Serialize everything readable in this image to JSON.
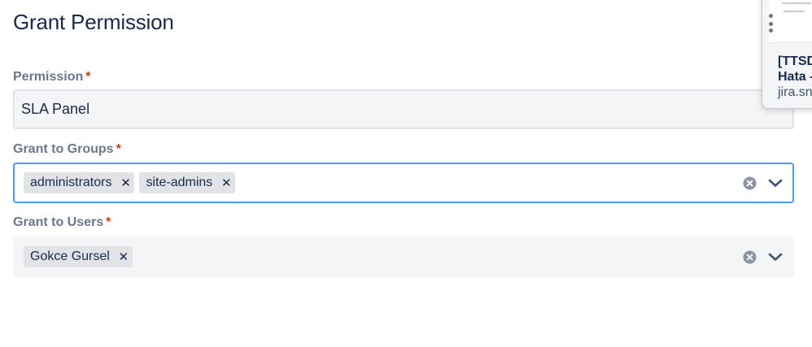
{
  "page": {
    "title": "Grant Permission"
  },
  "form": {
    "required_marker": "*",
    "permission": {
      "label": "Permission",
      "value": "SLA Panel"
    },
    "groups": {
      "label": "Grant to Groups",
      "tags": [
        "administrators",
        "site-admins"
      ],
      "remove_glyph": "✕"
    },
    "users": {
      "label": "Grant to Users",
      "tags": [
        "Gokce Gursel"
      ],
      "remove_glyph": "✕"
    }
  },
  "popover": {
    "title": "[TTSD",
    "subtitle": "Hata -",
    "url": "jira.sn"
  },
  "icons": {
    "clear": "clear-circle-x-icon",
    "dropdown": "chevron-down-icon",
    "remove": "close-x-icon"
  },
  "colors": {
    "focus_border": "#4c9aff",
    "required": "#de350b",
    "label": "#6b778c",
    "text": "#172b4d",
    "field_bg": "#f4f5f7",
    "tag_bg": "#e1e3e7"
  }
}
